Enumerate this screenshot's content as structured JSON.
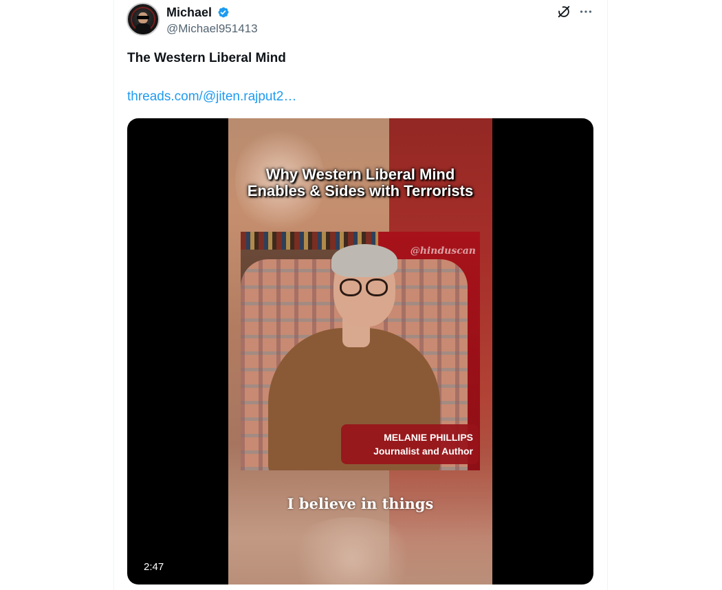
{
  "author": {
    "display_name": "Michael",
    "handle": "@Michael951413",
    "verified": true
  },
  "icons": {
    "verified": "verified-badge-icon",
    "grok": "grok-icon",
    "more": "more-icon"
  },
  "post": {
    "text": "The Western Liberal Mind",
    "link_text": "threads.com/@jiten.rajput2…"
  },
  "video": {
    "title_line1": "Why Western Liberal Mind",
    "title_line2": "Enables & Sides with Terrorists",
    "watermark": "@hinduscan",
    "lower_third_name": "MELANIE PHILLIPS",
    "lower_third_role": "Journalist and Author",
    "subtitle": "I believe in things",
    "duration": "2:47"
  },
  "colors": {
    "text_primary": "#0f1419",
    "text_secondary": "#536471",
    "link": "#1d9bf0",
    "verified": "#1d9bf0",
    "lower_third": "#98141a"
  }
}
